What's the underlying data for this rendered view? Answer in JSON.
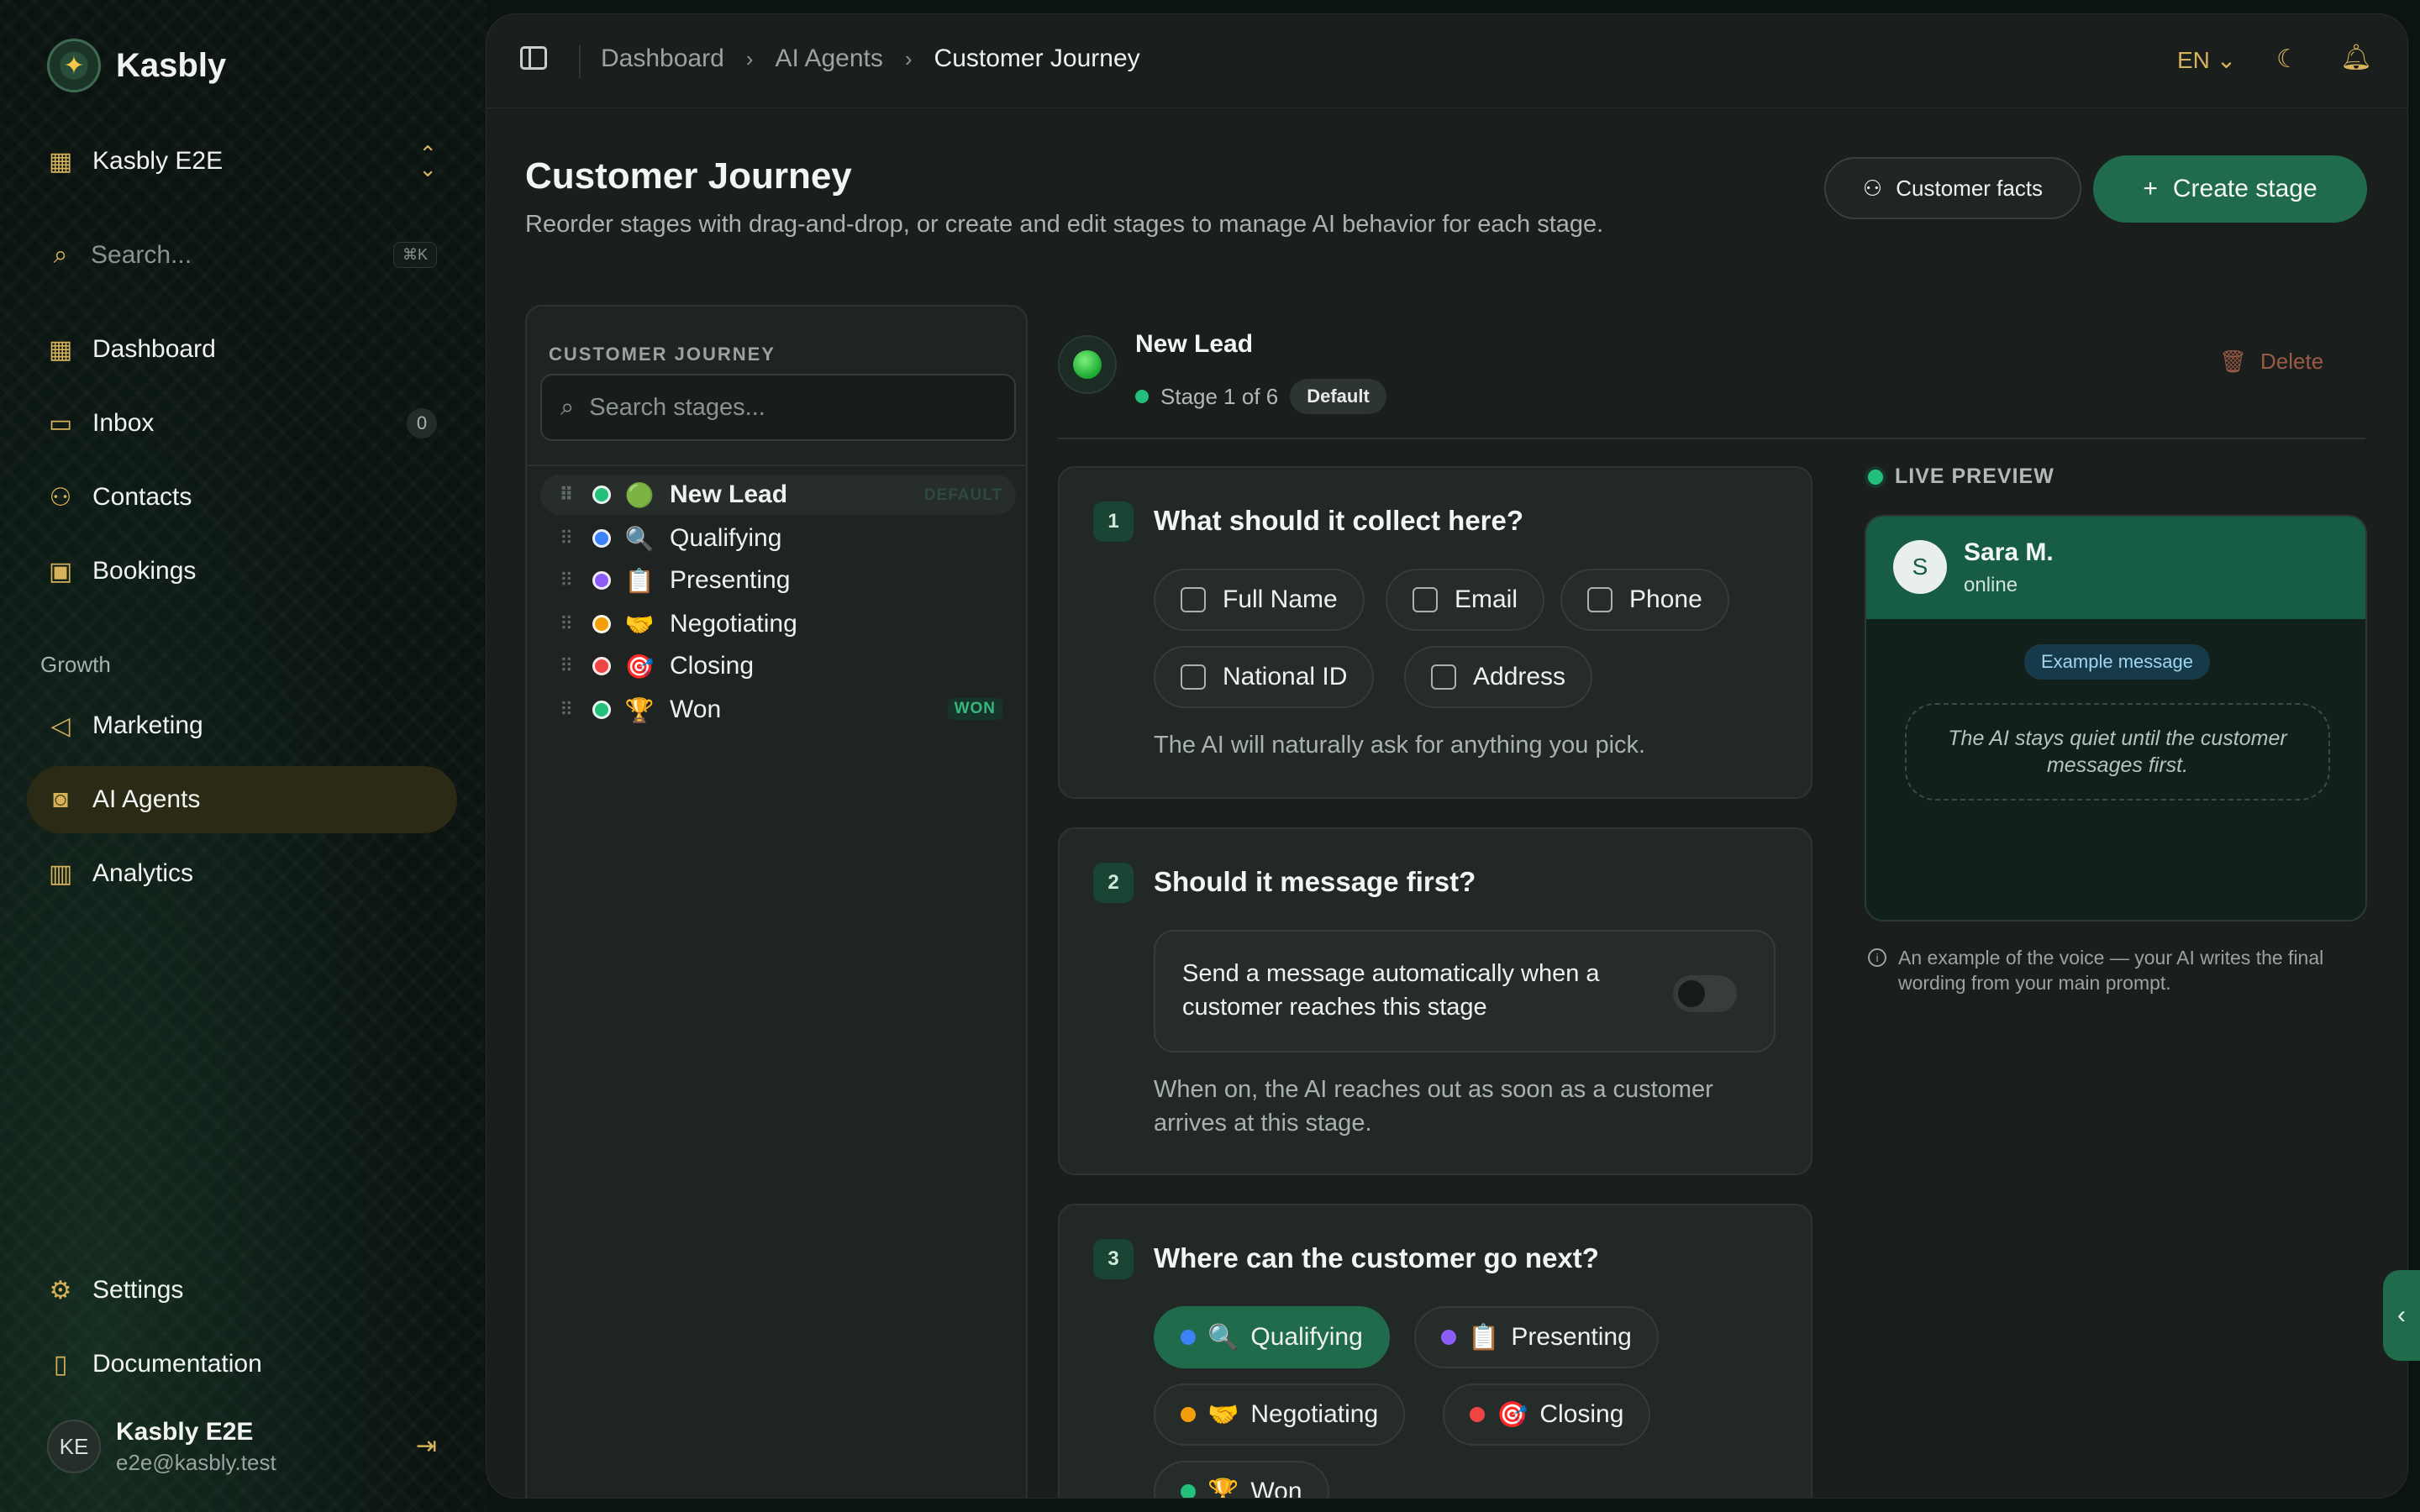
{
  "brand": {
    "name": "Kasbly",
    "logo_icon": "spark-logo-icon"
  },
  "workspace": {
    "name": "Kasbly E2E"
  },
  "sidebar_search": {
    "placeholder": "Search...",
    "shortcut": "⌘K"
  },
  "nav": {
    "dashboard": "Dashboard",
    "inbox": "Inbox",
    "inbox_count": "0",
    "contacts": "Contacts",
    "bookings": "Bookings",
    "group_growth": "Growth",
    "marketing": "Marketing",
    "ai_agents": "AI Agents",
    "analytics": "Analytics",
    "settings": "Settings",
    "documentation": "Documentation"
  },
  "user": {
    "initials": "KE",
    "name": "Kasbly E2E",
    "email": "e2e@kasbly.test"
  },
  "breadcrumb": [
    "Dashboard",
    "AI Agents",
    "Customer Journey"
  ],
  "topbar": {
    "language": "EN"
  },
  "page": {
    "title": "Customer Journey",
    "subtitle": "Reorder stages with drag-and-drop, or create and edit stages to manage AI behavior for each stage.",
    "facts_button": "Customer facts",
    "create_button": "Create stage"
  },
  "stage_list": {
    "header": "CUSTOMER JOURNEY",
    "search_placeholder": "Search stages...",
    "stages": [
      {
        "emoji": "🟢",
        "label": "New Lead",
        "color": "#22c07a",
        "tag": "DEFAULT"
      },
      {
        "emoji": "🔍",
        "label": "Qualifying",
        "color": "#3b82f6",
        "tag": ""
      },
      {
        "emoji": "📋",
        "label": "Presenting",
        "color": "#8b5cf6",
        "tag": ""
      },
      {
        "emoji": "🤝",
        "label": "Negotiating",
        "color": "#f59e0b",
        "tag": ""
      },
      {
        "emoji": "🎯",
        "label": "Closing",
        "color": "#ef4444",
        "tag": ""
      },
      {
        "emoji": "🏆",
        "label": "Won",
        "color": "#22c07a",
        "tag": "WON"
      }
    ]
  },
  "stage": {
    "name": "New Lead",
    "position": "Stage 1 of 6",
    "badge": "Default",
    "delete_label": "Delete"
  },
  "q1": {
    "num": "1",
    "title": "What should it collect here?",
    "fields": [
      "Full Name",
      "Email",
      "Phone",
      "National ID",
      "Address"
    ],
    "hint": "The AI will naturally ask for anything you pick."
  },
  "q2": {
    "num": "2",
    "title": "Should it message first?",
    "toggle_label": "Send a message automatically when a customer reaches this stage",
    "toggle_on": false,
    "hint": "When on, the AI reaches out as soon as a customer arrives at this stage."
  },
  "q3": {
    "num": "3",
    "title": "Where can the customer go next?",
    "options": [
      {
        "emoji": "🔍",
        "label": "Qualifying",
        "selected": true
      },
      {
        "emoji": "📋",
        "label": "Presenting",
        "selected": false
      },
      {
        "emoji": "🤝",
        "label": "Negotiating",
        "selected": false
      },
      {
        "emoji": "🎯",
        "label": "Closing",
        "selected": false
      },
      {
        "emoji": "🏆",
        "label": "Won",
        "selected": false
      }
    ]
  },
  "preview": {
    "header": "LIVE PREVIEW",
    "avatar": "S",
    "contact_name": "Sara M.",
    "status": "online",
    "example_badge": "Example message",
    "example_text": "The AI stays quiet until the customer messages first.",
    "note": "An example of the voice — your AI writes the final wording from your main prompt."
  },
  "colors": {
    "accent": "#1f6b4c",
    "gold": "#d6b25a"
  }
}
